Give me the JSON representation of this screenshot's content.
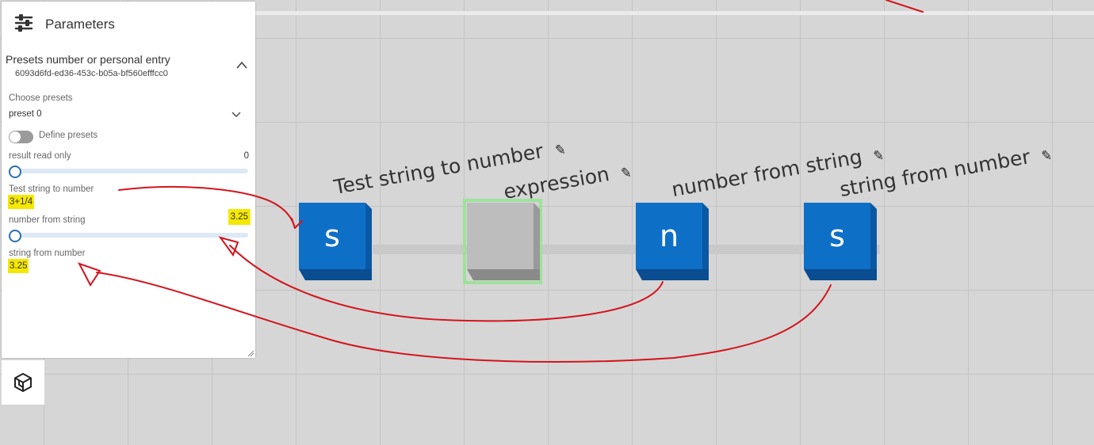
{
  "panel": {
    "title": "Parameters",
    "section": {
      "title": "Presets number or personal entry",
      "id": "6093d6fd-ed36-453c-b05a-bf560efffcc0"
    },
    "choose_presets_label": "Choose presets",
    "preset_value": "preset 0",
    "define_presets_label": "Define presets",
    "define_presets_on": false,
    "result_read_only": {
      "label": "result read only",
      "value": "0",
      "slider_fraction": 0
    },
    "test_string_to_number": {
      "label": "Test string to number",
      "value": "3+1/4"
    },
    "number_from_string": {
      "label": "number from string",
      "value": "3.25",
      "slider_fraction": 0
    },
    "string_from_number": {
      "label": "string from number",
      "value": "3.25"
    }
  },
  "canvas": {
    "nodes": [
      {
        "letter": "s",
        "label": "Test string to number",
        "color": "#0e6fc7"
      },
      {
        "letter": "",
        "label": "expression",
        "color": "#bdbdbd",
        "selected": true
      },
      {
        "letter": "n",
        "label": "number from string",
        "color": "#0e6fc7"
      },
      {
        "letter": "s",
        "label": "string from number",
        "color": "#0e6fc7"
      }
    ]
  },
  "colors": {
    "highlight": "#f5e800",
    "annotation_red": "#d4141c",
    "node_blue": "#0e6fc7",
    "selection_green": "#9de29b"
  },
  "icons": [
    "sliders-icon",
    "chevron-up-icon",
    "chevron-down-icon",
    "pencil-icon",
    "app-logo-icon",
    "resize-grip-icon"
  ]
}
